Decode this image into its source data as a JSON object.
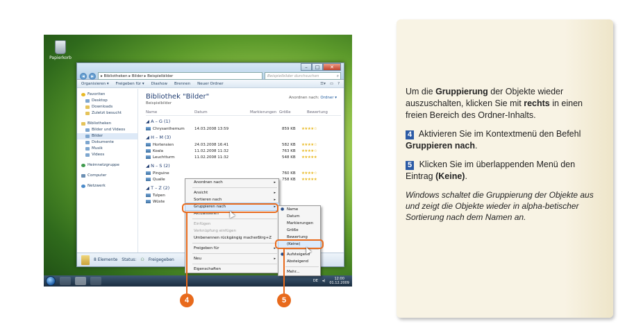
{
  "desktop": {
    "recycle_bin_label": "Papierkorb"
  },
  "explorer": {
    "window_buttons": {
      "minimize": "–",
      "maximize": "□",
      "close": "✕"
    },
    "address_path": "▸ Bibliotheken ▸ Bilder ▸ Beispielbilder",
    "search_placeholder": "Beispielbilder durchsuchen",
    "toolbar": [
      "Organisieren ▾",
      "Freigeben für ▾",
      "Diashow",
      "Brennen",
      "Neuer Ordner"
    ],
    "nav": {
      "favorites": "Favoriten",
      "desktop": "Desktop",
      "downloads": "Downloads",
      "recent": "Zuletzt besucht",
      "libraries": "Bibliotheken",
      "pictures_videos": "Bilder und Videos",
      "pictures": "Bilder",
      "documents": "Dokumente",
      "music": "Musik",
      "videos": "Videos",
      "homegroup": "Heimnetzgruppe",
      "computer": "Computer",
      "network": "Netzwerk"
    },
    "library_title": "Bibliothek \"Bilder\"",
    "library_subtitle": "Beispielbilder",
    "arrange_label": "Anordnen nach:",
    "arrange_value": "Ordner ▾",
    "columns": {
      "name": "Name",
      "date": "Datum",
      "tags": "Markierungen",
      "size": "Größe",
      "rating": "Bewertung"
    },
    "groups": [
      {
        "label": "◢ A – G (1)",
        "rows": [
          {
            "name": "Chrysanthemum",
            "date": "14.03.2008 13:59",
            "size": "859 KB"
          }
        ]
      },
      {
        "label": "◢ H – M (3)",
        "rows": [
          {
            "name": "Hortensien",
            "date": "24.03.2008 16:41",
            "size": "582 KB"
          },
          {
            "name": "Koala",
            "date": "11.02.2008 11:32",
            "size": "763 KB"
          },
          {
            "name": "Leuchtturm",
            "date": "11.02.2008 11:32",
            "size": "548 KB"
          }
        ]
      },
      {
        "label": "◢ N – S (2)",
        "rows": [
          {
            "name": "Pinguine",
            "date": "",
            "size": "760 KB"
          },
          {
            "name": "Qualle",
            "date": "",
            "size": "758 KB"
          }
        ]
      },
      {
        "label": "◢ T – Z (2)",
        "rows": [
          {
            "name": "Tulpen",
            "date": "",
            "size": ""
          },
          {
            "name": "Wüste",
            "date": "",
            "size": ""
          }
        ]
      }
    ],
    "status_count": "8 Elemente",
    "status_label": "Status:",
    "status_value": "Freigegeben"
  },
  "context_menu": {
    "items": [
      "Anordnen nach",
      "Ansicht",
      "Sortieren nach",
      "Gruppieren nach",
      "Aktualisieren",
      "Einfügen",
      "Verknüpfung einfügen",
      "Umbenennen rückgängig machen",
      "Freigeben für",
      "Neu",
      "Eigenschaften"
    ],
    "undo_shortcut": "Strg+Z"
  },
  "submenu": {
    "items": [
      "Name",
      "Datum",
      "Markierungen",
      "Größe",
      "Bewertung",
      "(Keine)",
      "Aufsteigend",
      "Absteigend",
      "Mehr..."
    ]
  },
  "taskbar": {
    "lang": "DE",
    "time": "12:00",
    "date": "01.12.2009"
  },
  "callouts": {
    "a": "4",
    "b": "5"
  },
  "panel": {
    "p1_a": "Um die ",
    "p1_b": "Gruppierung",
    "p1_c": " der Objekte wieder auszuschalten, klicken Sie mit ",
    "p1_d": "rechts",
    "p1_e": " in einen freien Bereich des Ordner-Inhalts.",
    "p2_num": "4",
    "p2_a": " Aktivieren Sie im Kontextmenü den Befehl ",
    "p2_b": "Gruppieren nach",
    "p2_c": ".",
    "p3_num": "5",
    "p3_a": " Klicken Sie im überlappenden Menü den Eintrag ",
    "p3_b": "(Keine)",
    "p3_c": ".",
    "p4": "Windows schaltet die Gruppierung der Objekte aus und zeigt die Objekte wieder in alpha-betischer Sortierung nach dem Namen an."
  }
}
